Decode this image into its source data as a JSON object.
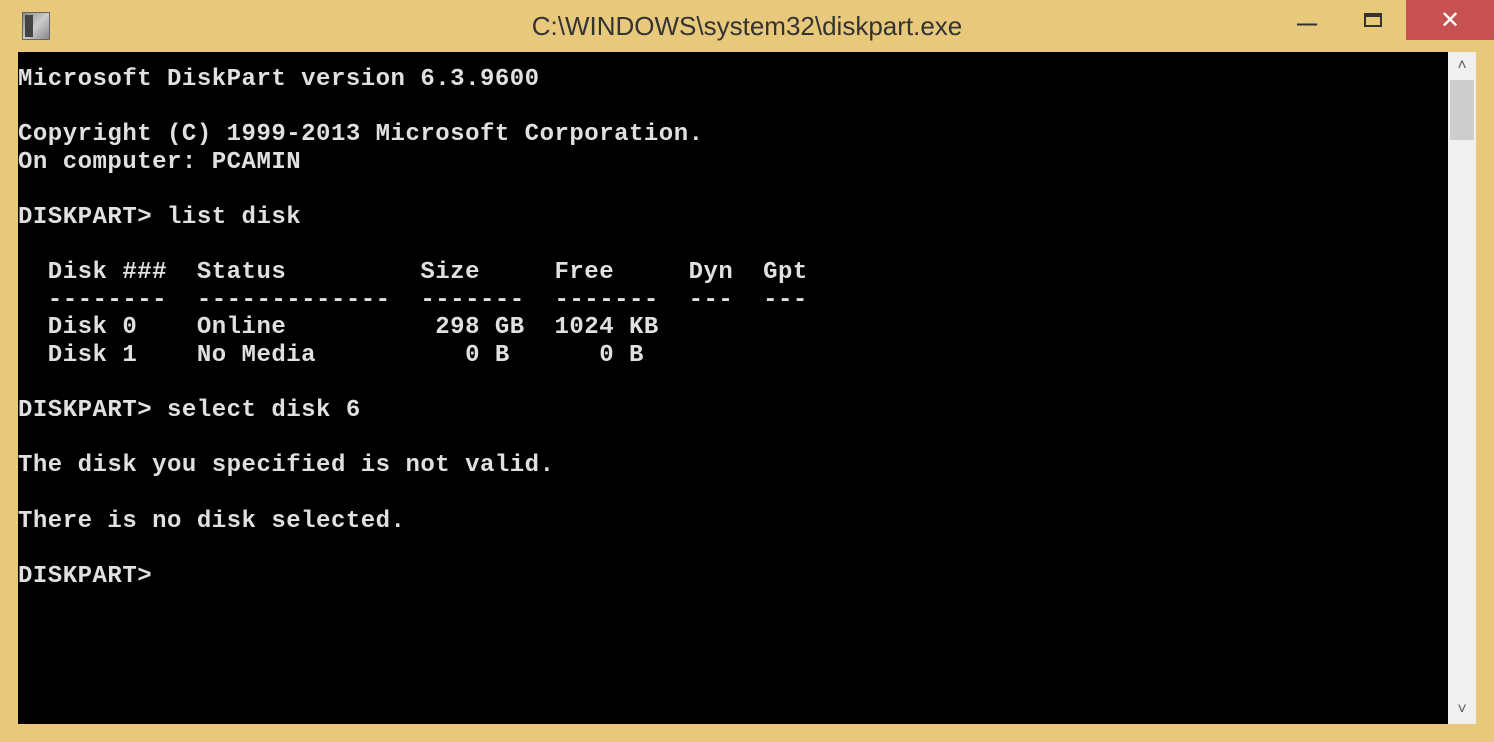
{
  "titlebar": {
    "title": "C:\\WINDOWS\\system32\\diskpart.exe"
  },
  "console": {
    "version_line": "Microsoft DiskPart version 6.3.9600",
    "copyright_line": "Copyright (C) 1999-2013 Microsoft Corporation.",
    "computer_line": "On computer: PCAMIN",
    "prompt1": "DISKPART> list disk",
    "table": {
      "header": "  Disk ###  Status         Size     Free     Dyn  Gpt",
      "separator": "  --------  -------------  -------  -------  ---  ---",
      "row0": "  Disk 0    Online          298 GB  1024 KB",
      "row1": "  Disk 1    No Media          0 B      0 B"
    },
    "prompt2": "DISKPART> select disk 6",
    "error1": "The disk you specified is not valid.",
    "error2": "There is no disk selected.",
    "prompt3": "DISKPART>"
  }
}
